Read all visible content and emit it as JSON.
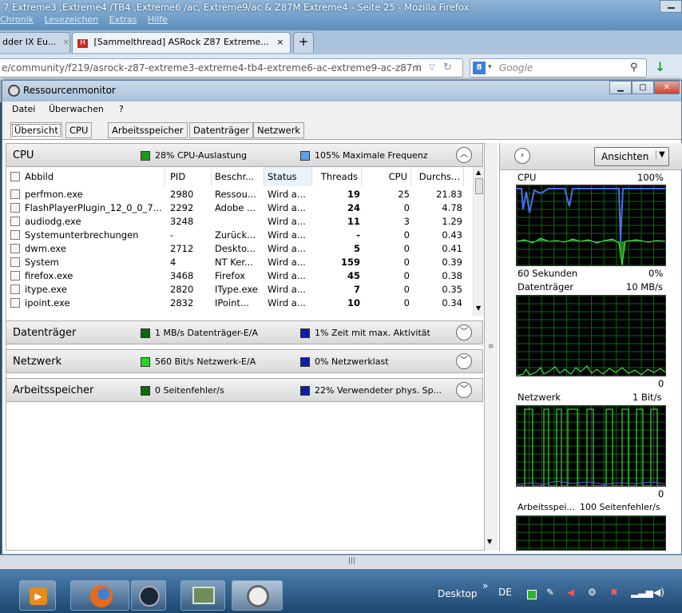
{
  "firefox": {
    "window_title": "7 Extreme3 ,Extreme4 /TB4 ,Extreme6 /ac, Extreme9/ac & Z87M Extreme4 - Seite 25 - Mozilla Firefox",
    "menu": [
      "Chronik",
      "Lesezeichen",
      "Extras",
      "Hilfe"
    ],
    "tabs": [
      {
        "label": "dder IX Eu...",
        "close": "×"
      },
      {
        "label": "[Sammelthread] ASRock Z87 Extreme...",
        "close": "×"
      }
    ],
    "new_tab": "+",
    "url": "e/community/f219/asrock-z87-extreme3-extreme4-tb4-extreme6-ac-extreme9-ac-z87m",
    "search_placeholder": "Google",
    "search_engine_badge": "8"
  },
  "resmon": {
    "title": "Ressourcenmonitor",
    "menu": [
      "Datei",
      "Überwachen",
      "?"
    ],
    "tabs": [
      "Übersicht",
      "CPU",
      "Arbeitsspeicher",
      "Datenträger",
      "Netzwerk"
    ],
    "cpu_section": {
      "name": "CPU",
      "stat1": "28% CPU-Auslastung",
      "stat2": "105% Maximale Frequenz",
      "stat1_color": "#1c9a1c",
      "stat2_color": "#5ba0e6"
    },
    "columns": [
      "Abbild",
      "PID",
      "Beschr...",
      "Status",
      "Threads",
      "CPU",
      "Durchs..."
    ],
    "processes": [
      {
        "image": "perfmon.exe",
        "pid": "2980",
        "desc": "Ressou...",
        "status": "Wird a...",
        "threads": "19",
        "cpu": "25",
        "avg": "21.83"
      },
      {
        "image": "FlashPlayerPlugin_12_0_0_7...",
        "pid": "2292",
        "desc": "Adobe ...",
        "status": "Wird a...",
        "threads": "24",
        "cpu": "0",
        "avg": "4.78"
      },
      {
        "image": "audiodg.exe",
        "pid": "3248",
        "desc": "",
        "status": "Wird a...",
        "threads": "11",
        "cpu": "3",
        "avg": "1.29"
      },
      {
        "image": "Systemunterbrechungen",
        "pid": "-",
        "desc": "Zurück...",
        "status": "Wird a...",
        "threads": "-",
        "cpu": "0",
        "avg": "0.43"
      },
      {
        "image": "dwm.exe",
        "pid": "2712",
        "desc": "Deskto...",
        "status": "Wird a...",
        "threads": "5",
        "cpu": "0",
        "avg": "0.41"
      },
      {
        "image": "System",
        "pid": "4",
        "desc": "NT Ker...",
        "status": "Wird a...",
        "threads": "159",
        "cpu": "0",
        "avg": "0.39"
      },
      {
        "image": "firefox.exe",
        "pid": "3468",
        "desc": "Firefox",
        "status": "Wird a...",
        "threads": "45",
        "cpu": "0",
        "avg": "0.38"
      },
      {
        "image": "itype.exe",
        "pid": "2820",
        "desc": "IType.exe",
        "status": "Wird a...",
        "threads": "7",
        "cpu": "0",
        "avg": "0.35"
      },
      {
        "image": "ipoint.exe",
        "pid": "2832",
        "desc": "IPoint...",
        "status": "Wird a...",
        "threads": "10",
        "cpu": "0",
        "avg": "0.34"
      }
    ],
    "disk_section": {
      "name": "Datenträger",
      "stat1": "1 MB/s Datenträger-E/A",
      "stat2": "1% Zeit mit max. Aktivität",
      "stat1_color": "#0c6a0c",
      "stat2_color": "#0b1fa8"
    },
    "net_section": {
      "name": "Netzwerk",
      "stat1": "560 Bit/s Netzwerk-E/A",
      "stat2": "0% Netzwerklast",
      "stat1_color": "#21d921",
      "stat2_color": "#0b1fa8"
    },
    "mem_section": {
      "name": "Arbeitsspeicher",
      "stat1": "0 Seitenfehler/s",
      "stat2": "22% Verwendeter phys. Sp...",
      "stat1_color": "#0c6a0c",
      "stat2_color": "#0b1fa8"
    },
    "views_button": "Ansichten",
    "graphs": {
      "cpu": {
        "label": "CPU",
        "max": "100%",
        "bottom_left": "60 Sekunden",
        "bottom_right": "0%"
      },
      "disk": {
        "label": "Datenträger",
        "max": "10 MB/s",
        "bottom_right": "0"
      },
      "net": {
        "label": "Netzwerk",
        "max": "1 Bit/s",
        "bottom_right": "0"
      },
      "mem": {
        "label": "Arbeitsspei...",
        "max": "100 Seitenfehler/s"
      }
    }
  },
  "taskbar": {
    "desktop_label": "Desktop",
    "lang": "DE",
    "overflow": "»"
  }
}
